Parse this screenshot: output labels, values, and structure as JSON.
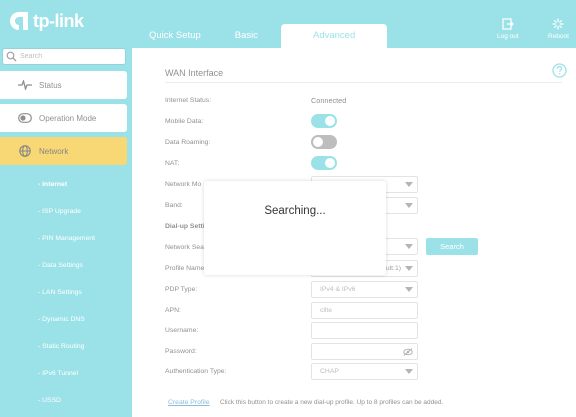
{
  "header": {
    "logo_text": "tp-link",
    "tabs": [
      "Quick Setup",
      "Basic",
      "Advanced"
    ],
    "active_tab": "Advanced",
    "logout_label": "Log out",
    "reboot_label": "Reboot",
    "accent_color": "#4acbd6"
  },
  "sidebar": {
    "search_placeholder": "Search",
    "items": [
      {
        "label": "Status",
        "icon": "pulse-icon"
      },
      {
        "label": "Operation Mode",
        "icon": "toggle-icon"
      },
      {
        "label": "Network",
        "icon": "globe-icon",
        "active": true
      }
    ],
    "submenu": [
      "- Internet",
      "- ISP Upgrade",
      "- PIN Management",
      "- Data Settings",
      "- LAN Settings",
      "- Dynamic DNS",
      "- Static Routing",
      "- IPv6 Tunnel",
      "- USSD"
    ],
    "active_color": "#f2b705"
  },
  "main": {
    "section_title": "WAN Interface",
    "internet_status_label": "Internet Status:",
    "internet_status_value": "Connected",
    "mobile_data_label": "Mobile Data:",
    "mobile_data_on": true,
    "data_roaming_label": "Data Roaming:",
    "data_roaming_on": false,
    "nat_label": "NAT:",
    "nat_on": true,
    "network_mode_label": "Network Mo",
    "band_label": "Band:",
    "dialup_label": "Dial-up Setti",
    "network_search_label": "Network Sea",
    "search_button": "Search",
    "profile_name_label": "Profile Name",
    "profile_name_value": "ult:1)",
    "pdp_type_label": "PDP Type:",
    "pdp_type_value": "IPv4 & IPv6",
    "apn_label": "APN:",
    "apn_value": "cllte",
    "username_label": "Username:",
    "password_label": "Password:",
    "auth_type_label": "Authentication Type:",
    "auth_type_value": "CHAP",
    "create_profile_link": "Create Profile",
    "create_profile_hint": "Click this button to create a new dial-up profile. Up to 8 profiles can be added."
  },
  "modal": {
    "text": "Searching..."
  }
}
